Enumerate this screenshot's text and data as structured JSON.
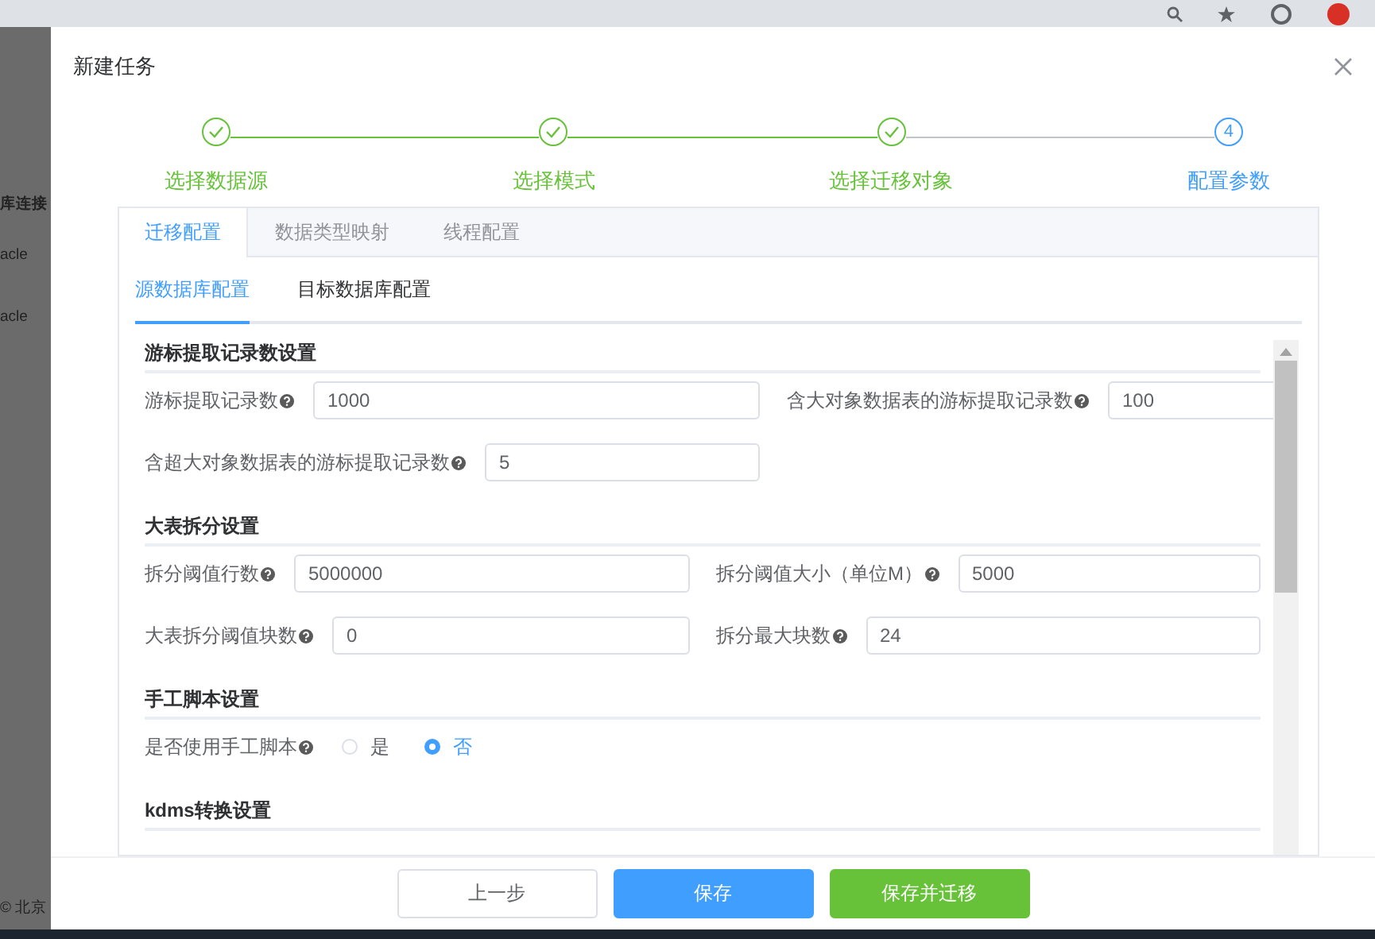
{
  "background_page": {
    "texts": [
      {
        "text": "库连接",
        "bold": true
      },
      {
        "text": "acle",
        "bold": false
      },
      {
        "text": "acle",
        "bold": false
      },
      {
        "text": "© 北京",
        "bold": false
      }
    ]
  },
  "dialog": {
    "title": "新建任务",
    "steps": [
      {
        "label": "选择数据源",
        "completed": true
      },
      {
        "label": "选择模式",
        "completed": true
      },
      {
        "label": "选择迁移对象",
        "completed": true
      },
      {
        "label": "配置参数",
        "completed": false,
        "number": "4"
      }
    ],
    "tabs": [
      {
        "label": "迁移配置",
        "selected": true
      },
      {
        "label": "数据类型映射",
        "selected": false
      },
      {
        "label": "线程配置",
        "selected": false
      }
    ],
    "subtabs": [
      {
        "label": "源数据库配置",
        "selected": true
      },
      {
        "label": "目标数据库配置",
        "selected": false
      }
    ],
    "sections": [
      {
        "title": "游标提取记录数设置",
        "fields": [
          {
            "kind": "input",
            "label": "游标提取记录数",
            "value": "1000"
          },
          {
            "kind": "input",
            "label": "含大对象数据表的游标提取记录数",
            "value": "100"
          },
          {
            "kind": "input",
            "label": "含超大对象数据表的游标提取记录数",
            "value": "5"
          }
        ]
      },
      {
        "title": "大表拆分设置",
        "fields": [
          {
            "kind": "input",
            "label": "拆分阈值行数",
            "value": "5000000"
          },
          {
            "kind": "input",
            "label": "拆分阈值大小（单位M）",
            "value": "5000"
          },
          {
            "kind": "input",
            "label": "大表拆分阈值块数",
            "value": "0"
          },
          {
            "kind": "input",
            "label": "拆分最大块数",
            "value": "24"
          }
        ]
      },
      {
        "title": "手工脚本设置",
        "fields": [
          {
            "kind": "radio",
            "label": "是否使用手工脚本",
            "options": [
              {
                "label": "是",
                "selected": false
              },
              {
                "label": "否",
                "selected": true
              }
            ]
          }
        ]
      },
      {
        "title": "kdms转换设置"
      }
    ],
    "buttons": [
      {
        "label": "上一步",
        "kind": "default"
      },
      {
        "label": "保存",
        "kind": "primary"
      },
      {
        "label": "保存并迁移",
        "kind": "success"
      }
    ]
  }
}
